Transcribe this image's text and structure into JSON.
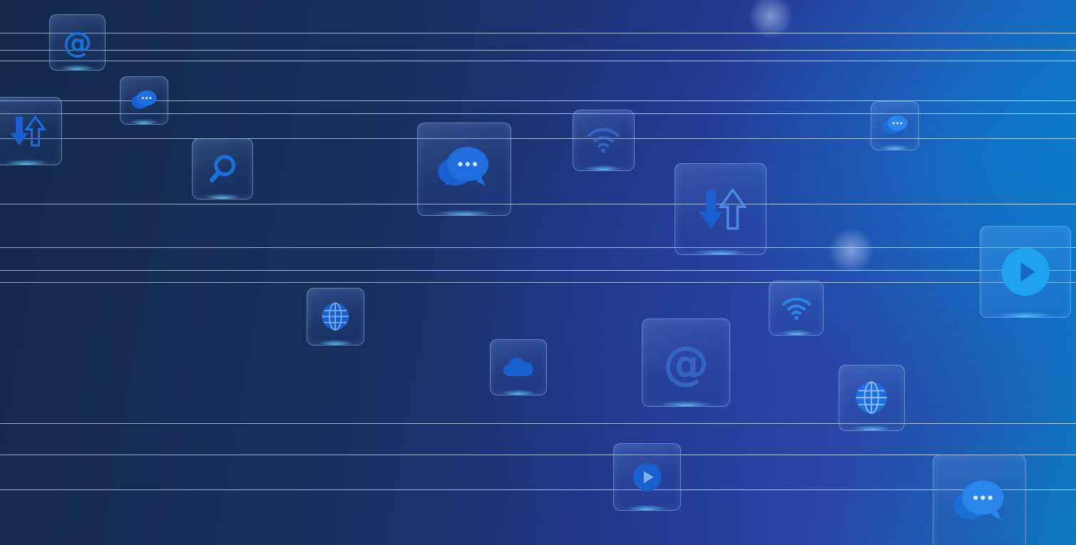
{
  "scene": {
    "description_colors": {
      "background_dark": "#13284c",
      "background_mid": "#22388f",
      "background_bright": "#0c79c5",
      "icon_blue": "#1a5fd0",
      "icon_bright": "#1fa3ef",
      "line_color": "#c8dcf0"
    },
    "icons": [
      "at-sign-icon",
      "chat-bubbles-icon",
      "transfer-arrows-icon",
      "search-icon",
      "wifi-icon",
      "globe-icon",
      "cloud-icon",
      "play-icon"
    ]
  }
}
